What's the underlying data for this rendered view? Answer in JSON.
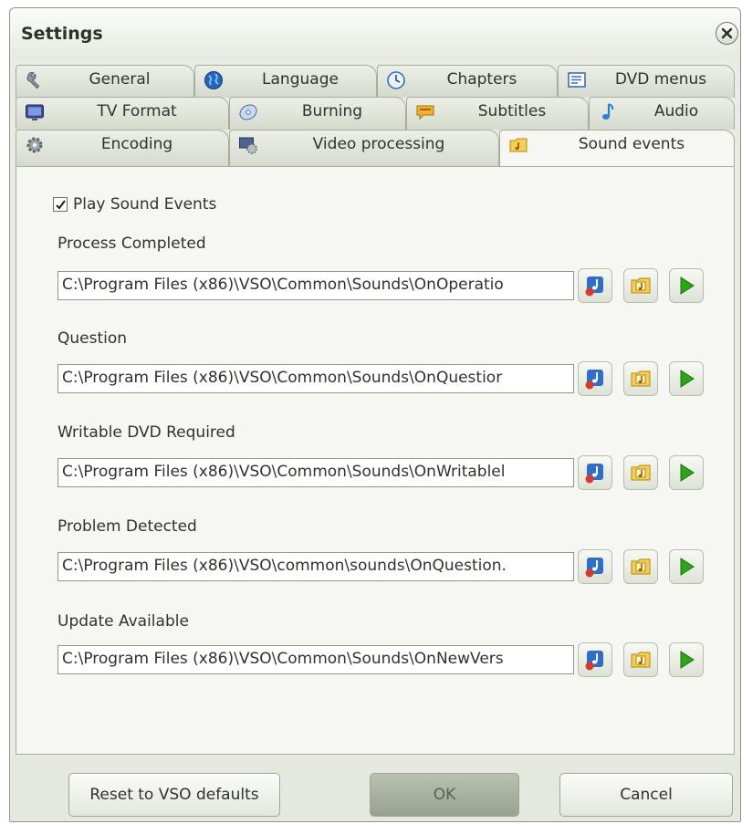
{
  "window": {
    "title": "Settings"
  },
  "tabs": {
    "row1": [
      {
        "label": "General",
        "icon": "wrench-icon"
      },
      {
        "label": "Language",
        "icon": "globe-icon"
      },
      {
        "label": "Chapters",
        "icon": "clock-icon"
      },
      {
        "label": "DVD menus",
        "icon": "menu-list-icon"
      }
    ],
    "row2": [
      {
        "label": "TV Format",
        "icon": "tv-icon"
      },
      {
        "label": "Burning",
        "icon": "disc-icon"
      },
      {
        "label": "Subtitles",
        "icon": "speech-bubble-icon"
      },
      {
        "label": "Audio",
        "icon": "music-note-icon"
      }
    ],
    "row3": [
      {
        "label": "Encoding",
        "icon": "gear-icon"
      },
      {
        "label": "Video processing",
        "icon": "video-settings-icon"
      },
      {
        "label": "Sound events",
        "icon": "sound-folder-icon",
        "active": true
      }
    ]
  },
  "sound_events": {
    "play_checkbox_label": "Play Sound Events",
    "play_checked": true,
    "events": [
      {
        "label": "Process Completed",
        "path": "C:\\Program Files (x86)\\VSO\\Common\\Sounds\\OnOperatio"
      },
      {
        "label": "Question",
        "path": "C:\\Program Files (x86)\\VSO\\Common\\Sounds\\OnQuestior"
      },
      {
        "label": "Writable DVD Required",
        "path": "C:\\Program Files (x86)\\VSO\\Common\\Sounds\\OnWritablel"
      },
      {
        "label": "Problem Detected",
        "path": "C:\\Program Files (x86)\\VSO\\common\\sounds\\OnQuestion."
      },
      {
        "label": "Update Available",
        "path": "C:\\Program Files (x86)\\VSO\\Common\\Sounds\\OnNewVers"
      }
    ]
  },
  "buttons": {
    "reset": "Reset to VSO defaults",
    "ok": "OK",
    "cancel": "Cancel"
  },
  "colors": {
    "accent_green": "#2fa31a",
    "panel": "#f6f7f3"
  }
}
